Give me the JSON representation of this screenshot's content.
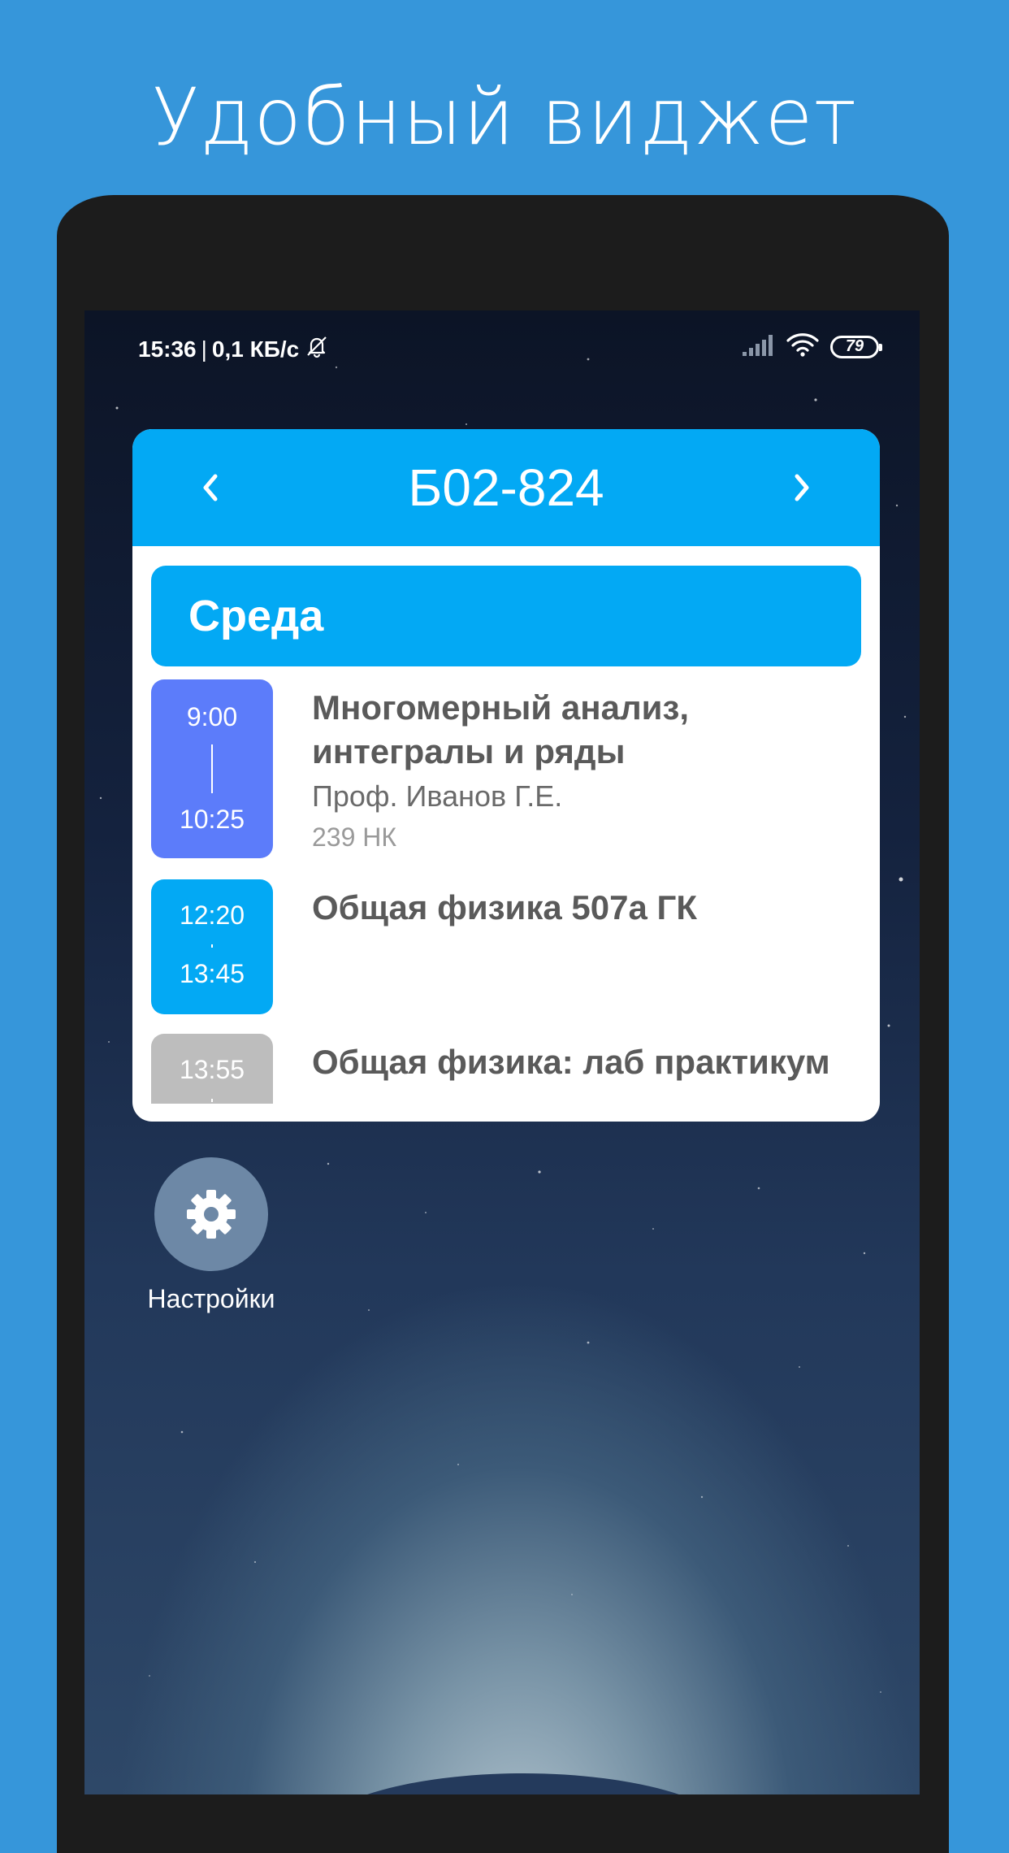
{
  "headline": "Удобный виджет",
  "status_bar": {
    "time": "15:36",
    "separator": "|",
    "speed": "0,1 КБ/с",
    "battery": "79",
    "icons": [
      "bell-off-icon",
      "signal-icon",
      "wifi-icon",
      "battery-icon"
    ]
  },
  "widget": {
    "group": "Б02-824",
    "prev_icon": "chevron-left-icon",
    "next_icon": "chevron-right-icon",
    "day": "Среда",
    "lessons": [
      {
        "start": "9:00",
        "end": "10:25",
        "title": "Многомерный анализ, интегралы и ряды",
        "teacher": "Проф. Иванов Г.Е.",
        "room": "239 НК",
        "color": "#5c7cfa"
      },
      {
        "start": "12:20",
        "end": "13:45",
        "title": "Общая физика 507а ГК",
        "teacher": "",
        "room": "",
        "color": "#03a9f4"
      },
      {
        "start": "13:55",
        "end": "",
        "title": "Общая физика: лаб практикум",
        "teacher": "",
        "room": "",
        "color": "#bdbdbd"
      }
    ]
  },
  "app_shortcut": {
    "label": "Настройки",
    "icon": "gear-icon"
  },
  "colors": {
    "background": "#3696da",
    "widget_accent": "#03a9f4"
  }
}
